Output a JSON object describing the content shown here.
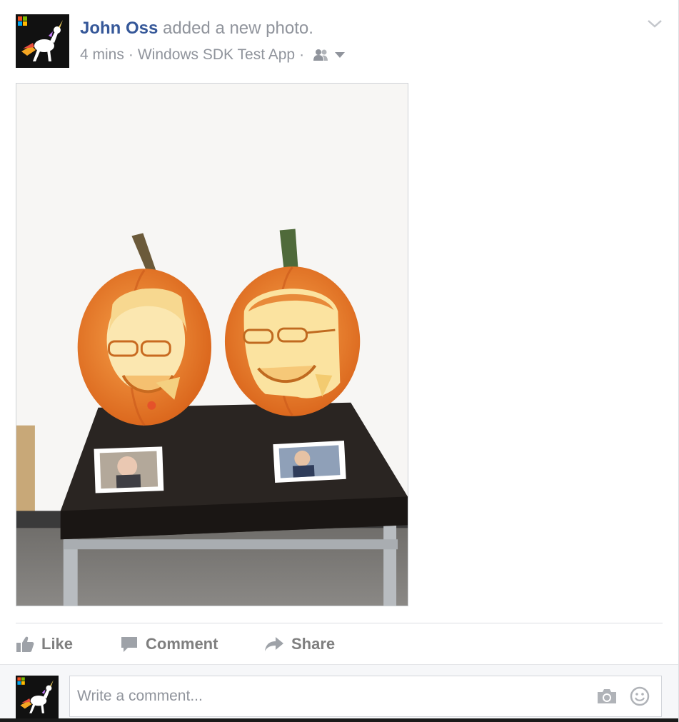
{
  "post": {
    "author": "John Oss",
    "action_text": "added a new photo.",
    "time": "4 mins",
    "separator": "·",
    "app_name": "Windows SDK Test App",
    "audience_icon": "friends-icon",
    "menu_icon": "chevron-down-icon"
  },
  "actions": {
    "like": "Like",
    "comment": "Comment",
    "share": "Share"
  },
  "comment_box": {
    "placeholder": "Write a comment...",
    "camera_icon": "camera-icon",
    "emoji_icon": "emoji-icon"
  },
  "colors": {
    "author_link": "#365899",
    "meta_text": "#90949c",
    "action_text": "#7f7f7f"
  }
}
